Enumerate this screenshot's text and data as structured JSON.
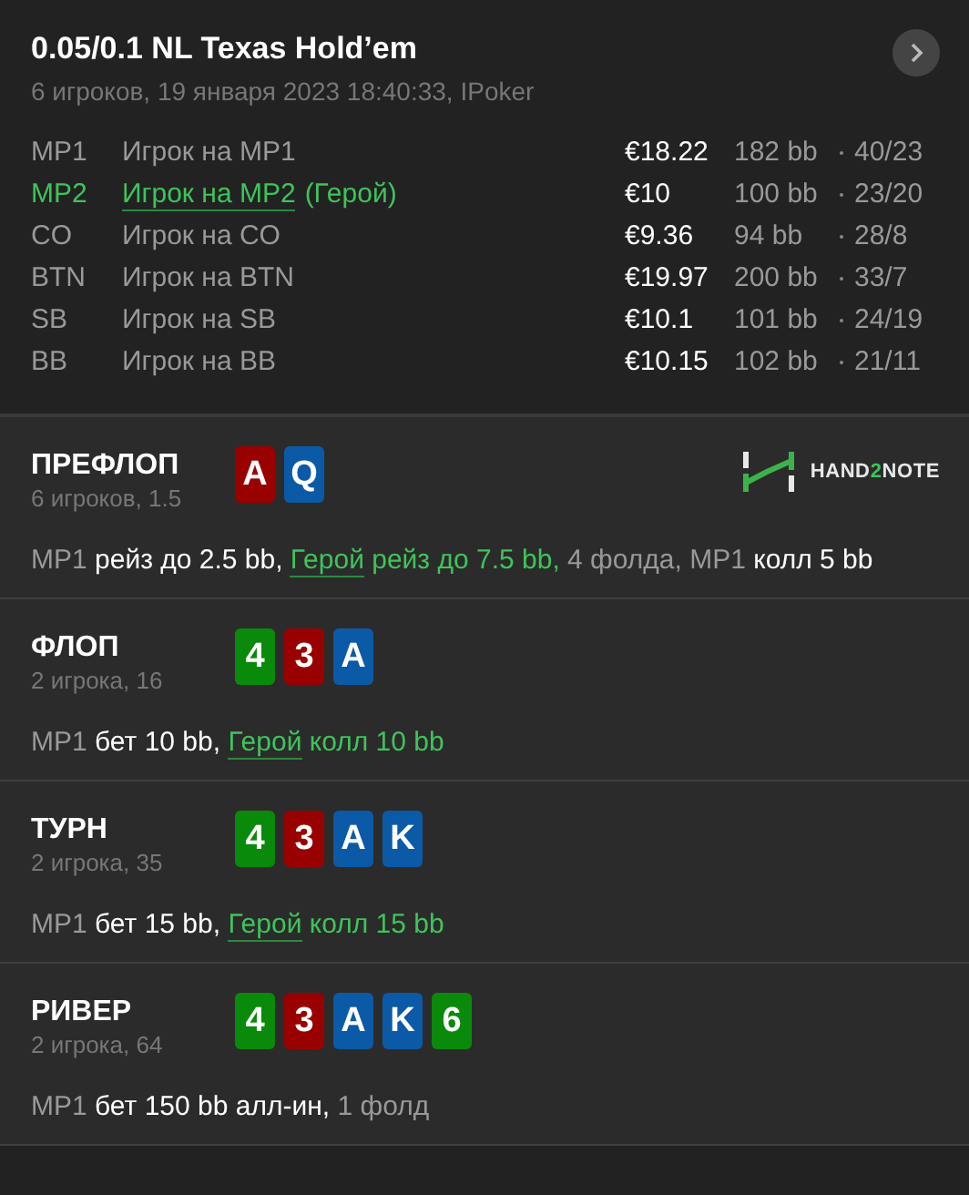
{
  "header": {
    "title": "0.05/0.1 NL Texas Hold’em",
    "subtitle": "6 игроков, 19 января 2023 18:40:33, IPoker"
  },
  "players": [
    {
      "position": "MP1",
      "name": "Игрок на MP1",
      "hero": false,
      "stack": "€18.22",
      "bb": "182 bb",
      "stats": "40/23"
    },
    {
      "position": "MP2",
      "name": "Игрок на MP2",
      "hero": true,
      "hero_tag": "(Герой)",
      "stack": "€10",
      "bb": "100 bb",
      "stats": "23/20"
    },
    {
      "position": "CO",
      "name": "Игрок на CO",
      "hero": false,
      "stack": "€9.36",
      "bb": "94 bb",
      "stats": "28/8"
    },
    {
      "position": "BTN",
      "name": "Игрок на BTN",
      "hero": false,
      "stack": "€19.97",
      "bb": "200 bb",
      "stats": "33/7"
    },
    {
      "position": "SB",
      "name": "Игрок на SB",
      "hero": false,
      "stack": "€10.1",
      "bb": "101 bb",
      "stats": "24/19"
    },
    {
      "position": "BB",
      "name": "Игрок на BB",
      "hero": false,
      "stack": "€10.15",
      "bb": "102 bb",
      "stats": "21/11"
    }
  ],
  "logo": {
    "parts": [
      {
        "text": "HAND",
        "accent": false
      },
      {
        "text": "2",
        "accent": true
      },
      {
        "text": "NOTE",
        "accent": false
      }
    ]
  },
  "streets": [
    {
      "name": "ПРЕФЛОП",
      "info": "6 игроков, 1.5",
      "cards": [
        {
          "rank": "A",
          "color": "#990000"
        },
        {
          "rank": "Q",
          "color": "#0b5aa8"
        }
      ],
      "actions": [
        {
          "kind": "actor",
          "text": "MP1"
        },
        {
          "kind": "action",
          "text": " рейз до 2.5 bb, "
        },
        {
          "kind": "hero",
          "text": "Герой"
        },
        {
          "kind": "hero-action",
          "text": " рейз до 7.5 bb,"
        },
        {
          "kind": "muted",
          "text": " 4 фолда, MP1"
        },
        {
          "kind": "action",
          "text": " колл 5 bb"
        }
      ]
    },
    {
      "name": "ФЛОП",
      "info": "2 игрока, 16",
      "cards": [
        {
          "rank": "4",
          "color": "#0a8a0a"
        },
        {
          "rank": "3",
          "color": "#990000"
        },
        {
          "rank": "A",
          "color": "#0b5aa8"
        }
      ],
      "actions": [
        {
          "kind": "actor",
          "text": "MP1"
        },
        {
          "kind": "action",
          "text": " бет 10 bb, "
        },
        {
          "kind": "hero",
          "text": "Герой"
        },
        {
          "kind": "hero-action",
          "text": " колл 10 bb"
        }
      ]
    },
    {
      "name": "ТУРН",
      "info": "2 игрока, 35",
      "cards": [
        {
          "rank": "4",
          "color": "#0a8a0a"
        },
        {
          "rank": "3",
          "color": "#990000"
        },
        {
          "rank": "A",
          "color": "#0b5aa8"
        },
        {
          "rank": "K",
          "color": "#0b5aa8"
        }
      ],
      "actions": [
        {
          "kind": "actor",
          "text": "MP1"
        },
        {
          "kind": "action",
          "text": " бет 15 bb, "
        },
        {
          "kind": "hero",
          "text": "Герой"
        },
        {
          "kind": "hero-action",
          "text": " колл 15 bb"
        }
      ]
    },
    {
      "name": "РИВЕР",
      "info": "2 игрока, 64",
      "cards": [
        {
          "rank": "4",
          "color": "#0a8a0a"
        },
        {
          "rank": "3",
          "color": "#990000"
        },
        {
          "rank": "A",
          "color": "#0b5aa8"
        },
        {
          "rank": "K",
          "color": "#0b5aa8"
        },
        {
          "rank": "6",
          "color": "#0a8a0a"
        }
      ],
      "actions": [
        {
          "kind": "actor",
          "text": "MP1"
        },
        {
          "kind": "action",
          "text": " бет 150 bb алл-ин,"
        },
        {
          "kind": "muted",
          "text": " 1 фолд"
        }
      ]
    }
  ]
}
